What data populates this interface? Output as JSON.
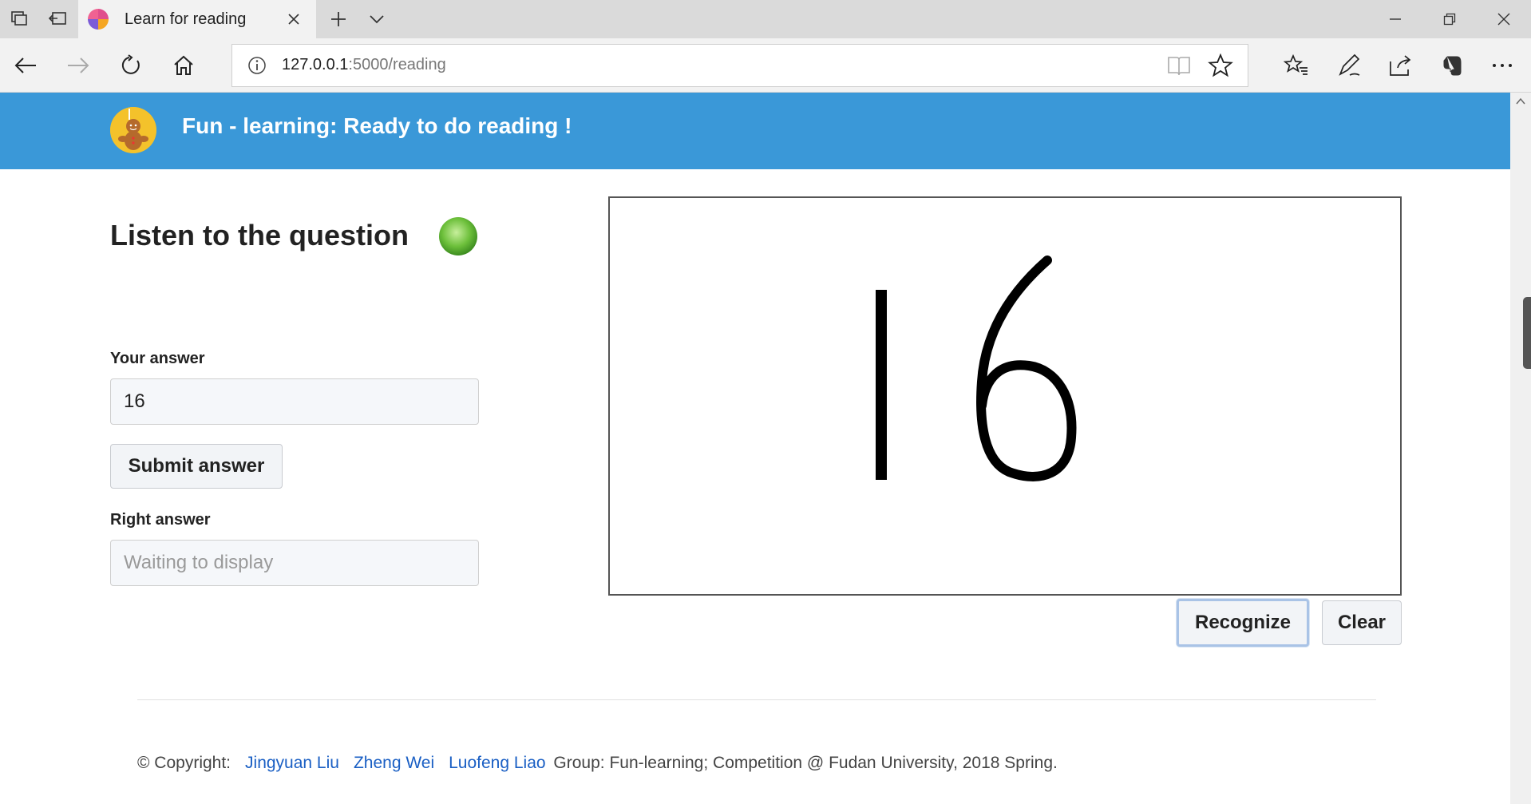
{
  "browser": {
    "tab_title": "Learn for reading",
    "url_host": "127.0.0.1",
    "url_path": ":5000/reading"
  },
  "header": {
    "title": "Fun - learning: Ready to do reading !"
  },
  "main": {
    "section_title": "Listen to the question",
    "your_answer_label": "Your answer",
    "your_answer_value": "16",
    "submit_label": "Submit answer",
    "right_answer_label": "Right answer",
    "right_answer_placeholder": "Waiting to display",
    "canvas_drawing": "16",
    "recognize_label": "Recognize",
    "clear_label": "Clear"
  },
  "footer": {
    "copyright": "© Copyright:",
    "author1": "Jingyuan Liu",
    "author2": "Zheng Wei",
    "author3": "Luofeng Liao",
    "tail": "Group: Fun-learning; Competition @ Fudan University, 2018 Spring."
  }
}
